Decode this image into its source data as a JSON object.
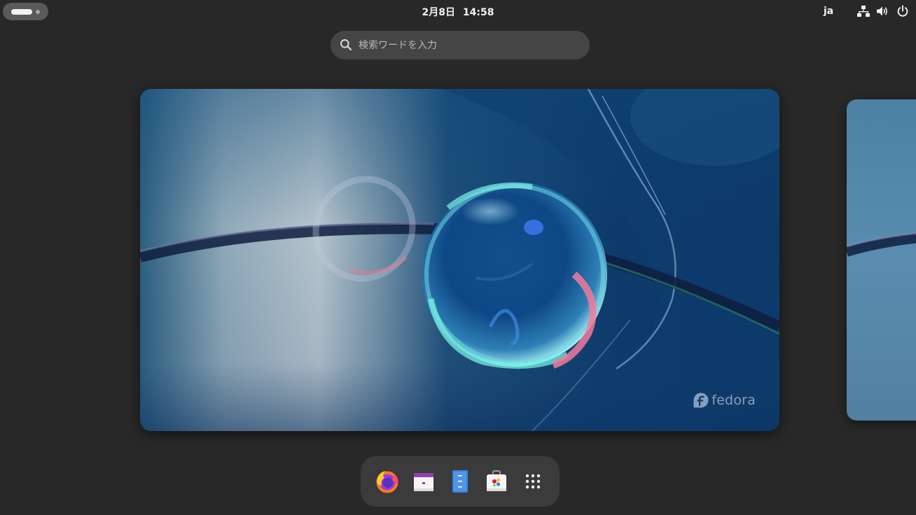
{
  "topbar": {
    "clock": {
      "date": "2月8日",
      "time": "14:58"
    },
    "input_source": "ja",
    "tray_icons": [
      "network-wired-icon",
      "volume-icon",
      "power-icon"
    ]
  },
  "search": {
    "placeholder": "検索ワードを入力",
    "value": ""
  },
  "workspace": {
    "wallpaper_brand": "fedora"
  },
  "dash": {
    "items": [
      {
        "name": "Firefox",
        "icon": "firefox-icon"
      },
      {
        "name": "Calendar",
        "icon": "calendar-icon"
      },
      {
        "name": "Text Editor",
        "icon": "text-editor-icon"
      },
      {
        "name": "Software",
        "icon": "software-icon"
      },
      {
        "name": "Show Applications",
        "icon": "app-grid-icon"
      }
    ]
  },
  "colors": {
    "background": "#282828",
    "panel_text": "#f2f2f2",
    "search_bg": "#454545",
    "dash_bg": "#3b3b3b"
  }
}
